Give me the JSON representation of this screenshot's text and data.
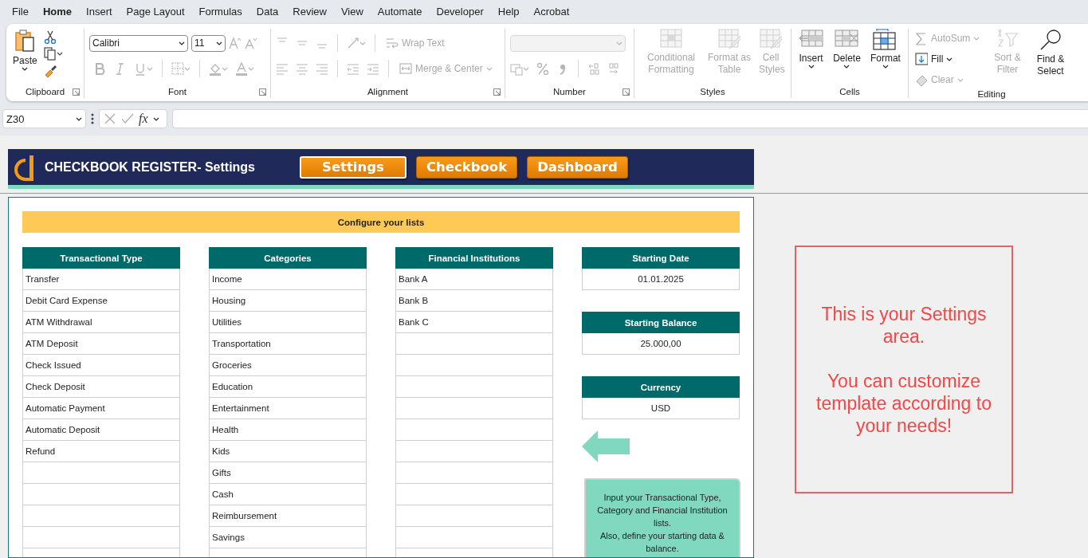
{
  "menu_tabs": [
    {
      "label": "File",
      "selected": false
    },
    {
      "label": "Home",
      "selected": true
    },
    {
      "label": "Insert",
      "selected": false
    },
    {
      "label": "Page Layout",
      "selected": false
    },
    {
      "label": "Formulas",
      "selected": false
    },
    {
      "label": "Data",
      "selected": false
    },
    {
      "label": "Review",
      "selected": false
    },
    {
      "label": "View",
      "selected": false
    },
    {
      "label": "Automate",
      "selected": false
    },
    {
      "label": "Developer",
      "selected": false
    },
    {
      "label": "Help",
      "selected": false
    },
    {
      "label": "Acrobat",
      "selected": false
    }
  ],
  "ribbon_groups": [
    {
      "label": "Clipboard",
      "buttons": [
        {
          "label": "Paste",
          "disabled": false
        }
      ]
    },
    {
      "label": "Font",
      "font_name": "Calibri",
      "font_size": "11"
    },
    {
      "label": "Alignment",
      "buttons": [
        {
          "label": "Wrap Text",
          "disabled": true
        },
        {
          "label": "Merge & Center",
          "disabled": true
        }
      ]
    },
    {
      "label": "Number"
    },
    {
      "label": "Styles",
      "buttons": [
        {
          "label": "Conditional Formatting",
          "disabled": true
        },
        {
          "label": "Format as Table",
          "disabled": true
        },
        {
          "label": "Cell Styles",
          "disabled": true
        }
      ]
    },
    {
      "label": "Cells",
      "buttons": [
        {
          "label": "Insert",
          "disabled": false
        },
        {
          "label": "Delete",
          "disabled": false
        },
        {
          "label": "Format",
          "disabled": false
        }
      ]
    },
    {
      "label": "Editing",
      "buttons": [
        {
          "label": "AutoSum",
          "disabled": true
        },
        {
          "label": "Fill",
          "disabled": false
        },
        {
          "label": "Clear",
          "disabled": true
        },
        {
          "label": "Sort & Filter",
          "disabled": true
        },
        {
          "label": "Find & Select",
          "disabled": false
        }
      ]
    }
  ],
  "formula_bar": {
    "name_box": "Z30",
    "function_label": "fx"
  },
  "banner": {
    "title": "CHECKBOOK REGISTER- Settings",
    "nav": [
      {
        "label": "Settings",
        "selected": true
      },
      {
        "label": "Checkbook",
        "selected": false
      },
      {
        "label": "Dashboard",
        "selected": false
      }
    ]
  },
  "configure_title": "Configure your lists",
  "lists": [
    {
      "header": "Transactional Type",
      "items": [
        "Transfer",
        "Debit Card Expense",
        "ATM Withdrawal",
        "ATM Deposit",
        "Check Issued",
        "Check Deposit",
        "Automatic Payment",
        "Automatic Deposit",
        "Refund"
      ]
    },
    {
      "header": "Categories",
      "items": [
        "Income",
        "Housing",
        "Utilities",
        "Transportation",
        "Groceries",
        "Education",
        "Entertainment",
        "Health",
        "Kids",
        "Gifts",
        "Cash",
        "Reimbursement",
        "Savings"
      ]
    },
    {
      "header": "Financial Institutions",
      "items": [
        "Bank A",
        "Bank B",
        "Bank C"
      ]
    }
  ],
  "settings": [
    {
      "header": "Starting Date",
      "value": "01.01.2025"
    },
    {
      "header": "Starting Balance",
      "value": "25.000,00"
    },
    {
      "header": "Currency",
      "value": "USD"
    }
  ],
  "hint_note": "Input your Transactional Type, Category and Financial Institution lists.\nAlso, define your starting data & balance.",
  "callout": "This is your Settings area.\n\nYou can customize template according to your needs!"
}
